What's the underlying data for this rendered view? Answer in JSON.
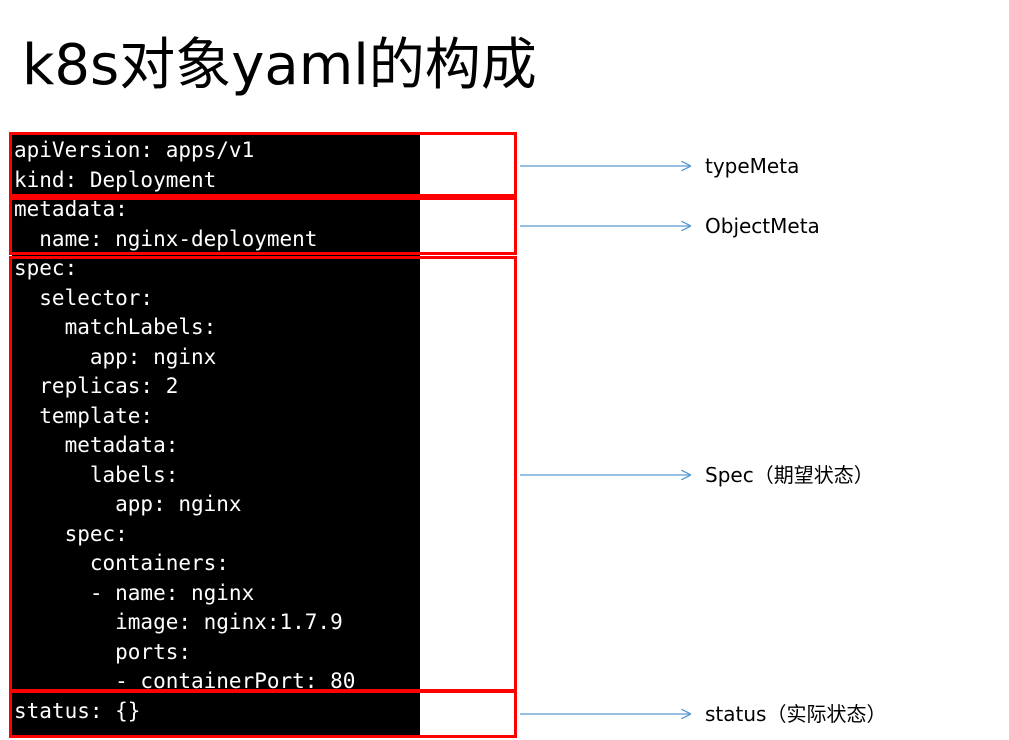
{
  "title": "k8s对象yaml的构成",
  "code_lines": [
    "apiVersion: apps/v1",
    "kind: Deployment",
    "metadata:",
    "  name: nginx-deployment",
    "spec:",
    "  selector:",
    "    matchLabels:",
    "      app: nginx",
    "  replicas: 2",
    "  template:",
    "    metadata:",
    "      labels:",
    "        app: nginx",
    "    spec:",
    "      containers:",
    "      - name: nginx",
    "        image: nginx:1.7.9",
    "        ports:",
    "        - containerPort: 80",
    "status: {}"
  ],
  "sections": [
    {
      "label": "typeMeta"
    },
    {
      "label": "ObjectMeta"
    },
    {
      "label": "Spec（期望状态）"
    },
    {
      "label": "status（实际状态）"
    }
  ],
  "colors": {
    "box_border": "#ff0000",
    "arrow": "#5b9bd5",
    "terminal_bg": "#000000",
    "terminal_text": "#ffffff"
  }
}
